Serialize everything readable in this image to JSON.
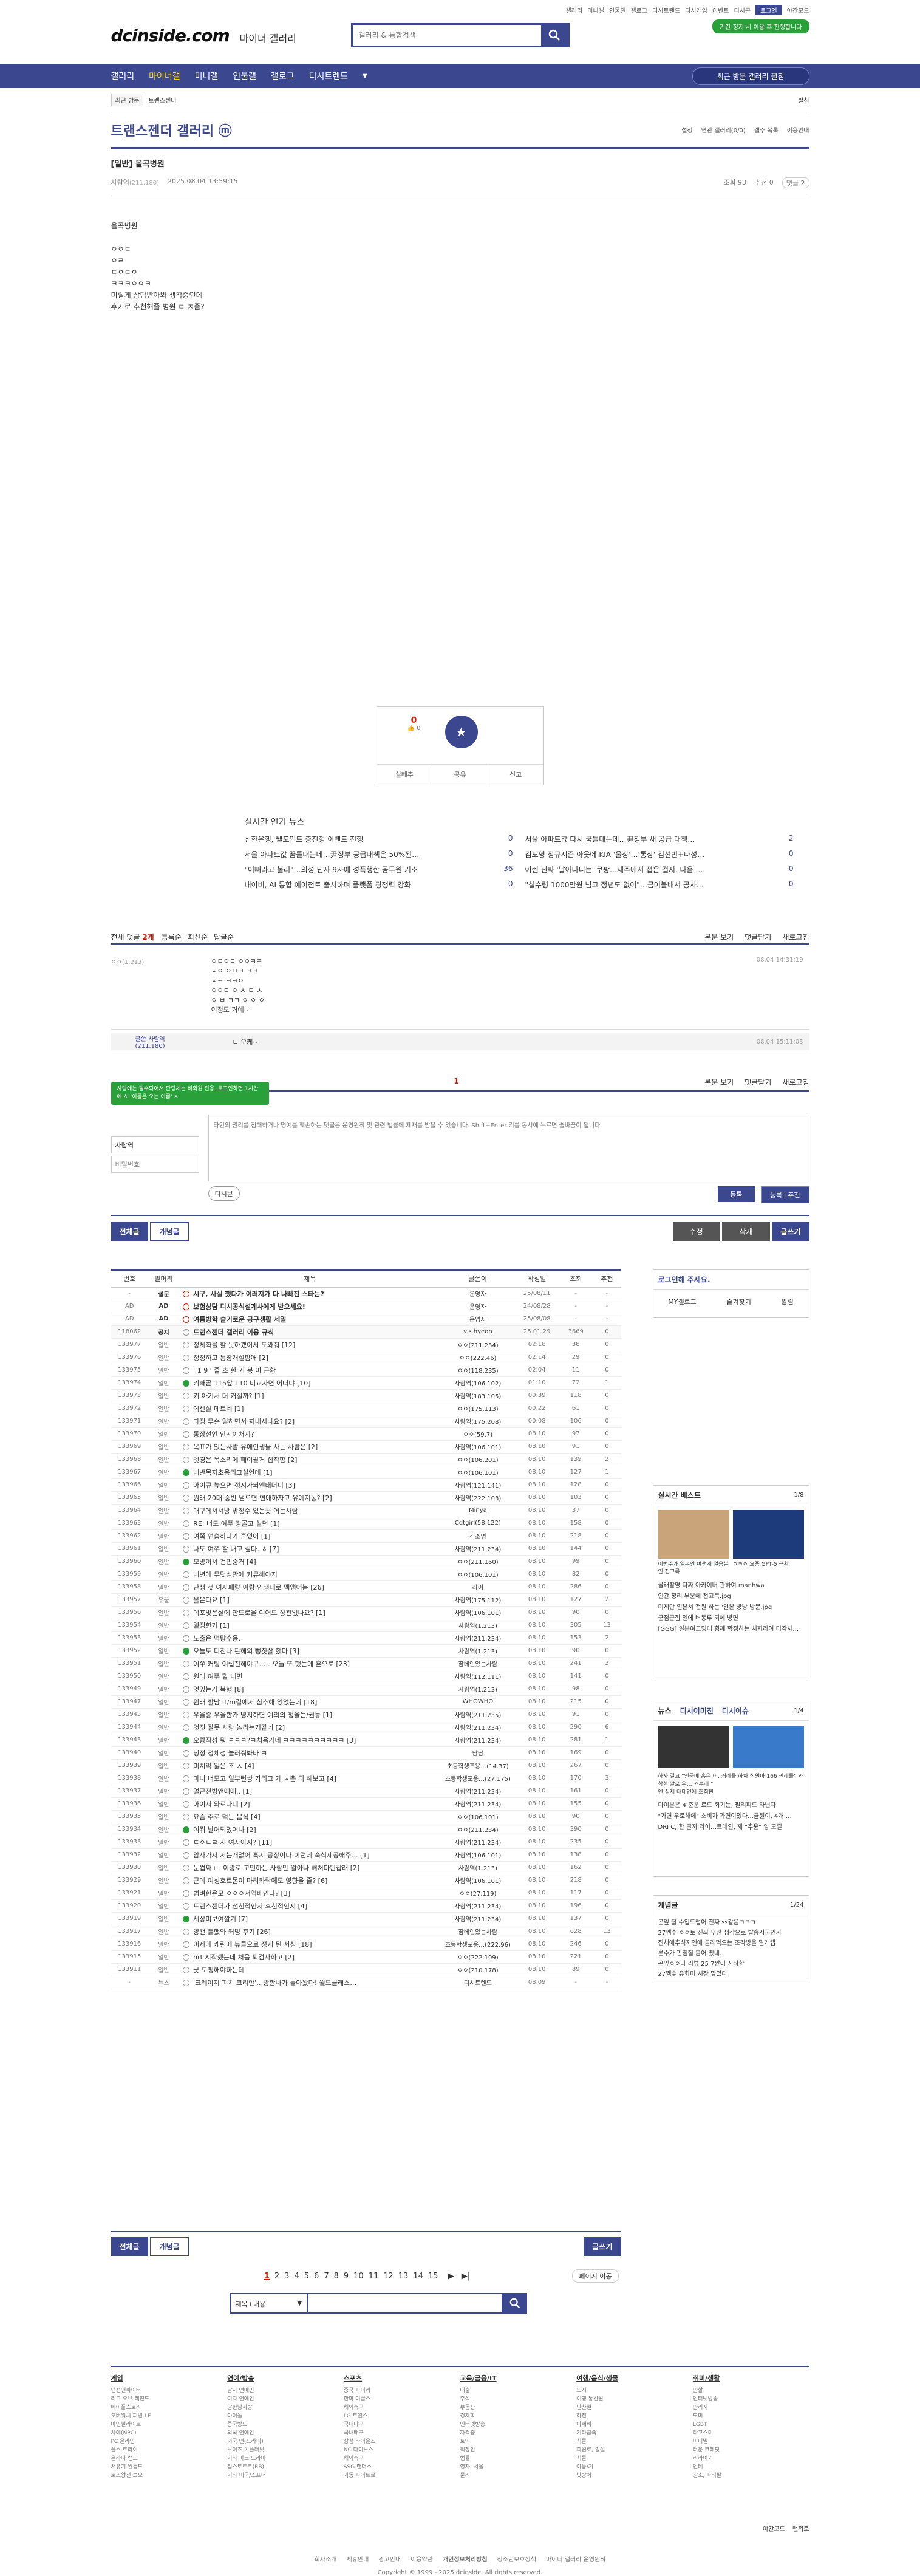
{
  "header": {
    "toplinks": [
      "갤러리",
      "미니갤",
      "인물갤",
      "갤로그",
      "디시트렌드",
      "디시게임",
      "이벤트",
      "디시콘",
      "로그인",
      "야간모드"
    ],
    "logo": "dcinside.com",
    "logo_sub": "마이너 갤러리",
    "search_placeholder": "갤러리 & 통합검색",
    "promo": "기간 정지 시 이용 후 진행합니다"
  },
  "gnb": {
    "items": [
      "갤러리",
      "마이너갤",
      "미니갤",
      "인물갤",
      "갤로그",
      "디시트렌드"
    ],
    "visited": "최근 방문 갤러리 펼침"
  },
  "subbar": {
    "recent": "최근 방문",
    "crumb": "트랜스젠더",
    "right": "펼침"
  },
  "gallery": {
    "title": "트랜스젠더 갤러리",
    "icon": "ⓜ",
    "right": [
      "설정",
      "연관 갤러리(0/0)",
      "갤주 목록",
      "이용안내"
    ]
  },
  "post": {
    "title": "[일반] 을곡병원",
    "author": "사람역",
    "ip": "(211.180)",
    "date": "2025.08.04 13:59:15",
    "views": "조회 93",
    "recommend": "추천 0",
    "comments": "댓글 2",
    "lines": [
      "을곡병원",
      "",
      "ㅇㅇㄷ",
      "ㅇㄹ",
      "ㄷㅇㄷㅇ",
      "ㅋㅋㅋㅇㅇㅋ",
      "미릴게 상담받아봐 생각중인데",
      "후기로 추천해줄 병원 ㄷ ㅈ좀?"
    ]
  },
  "rec": {
    "up": "0",
    "up_sub": "👍 0",
    "star": "개념",
    "share_a": "실베추",
    "share_b": "공유",
    "share_c": "신고"
  },
  "news": {
    "title": "실시간 인기 뉴스",
    "items": [
      [
        "신한은행, 웰포인트 충전형 이벤트 진행",
        "0"
      ],
      [
        "서울 아파트값 다시 꿈틀대는데…尹정부 새 공급 대책…",
        "2"
      ],
      [
        "서울 아파트값 꿈틀대는데…尹정부 공급대책은 50%된…",
        "0"
      ],
      [
        "김도영 정규시즌 아웃에 KIA '울상'…'통상' 김선빈+나성…",
        "0"
      ],
      [
        "\"어빼라고 불러\"…의성 닌자 9자에 성폭행한 공무원 기소",
        "36"
      ],
      [
        "어렌 진짜 '날아다니는' 쿠팡…제주에서 접은 걸지, 다음 …",
        "0"
      ],
      [
        "내이버, AI 통합 에이전트 출시하며 플랫폼 경쟁력 강화",
        "0"
      ],
      [
        "\"실수령 1000만원 넘고 정년도 없어\"…금어볼배서 공사…",
        "0"
      ]
    ]
  },
  "comments": {
    "label": "전체 댓글",
    "count": "2개",
    "sort": [
      "등록순",
      "최신순",
      "답글순"
    ],
    "right": [
      "본문 보기",
      "댓글닫기",
      "새로고침"
    ],
    "c1": {
      "who": "ㅇㅇ(1.213)",
      "date": "08.04 14:31:19",
      "lines": [
        "ㅇㄷㅇㄷ ㅇㅇㅋㅋ",
        "ㅅㅇ ㅇㅁㅋ ㅋㅋ",
        "ㅅㅋ ㅋㅋㅇ",
        "ㅇㅇㄷ ㅇ ㅅ ㅁ ㅅ",
        "ㅇ ㅂ ㅋㅋ ㅇ ㅇ ㅇ",
        "이정도 거예~"
      ]
    },
    "reply": {
      "who": "글쓴 사람역(211.180)",
      "txt": "ㄴ 오케~",
      "date": "08.04 15:11:03"
    },
    "page": "1",
    "tip": "사람에는 필수되어서 판링체는 비회원 전용. 로그인하면 1시간에 시 '이름은 오는 이름'",
    "name": "사람역",
    "pw_ph": "비밀번호",
    "ta_ph": "타인의 권리를 침해하거나 명예를 훼손하는 댓글은 운영원칙 및 관련 법률에 제재를 받을 수 있습니다. Shift+Enter 키를 동시에 누르면 줄바꿈이 됩니다.",
    "dccon": "디시콘",
    "submit": "등록",
    "submit2": "등록+추천"
  },
  "buttons": {
    "all": "전체글",
    "recommend": "개념글",
    "edit": "수정",
    "delete": "삭제",
    "write": "글쓰기"
  },
  "table": {
    "headers": [
      "번호",
      "말머리",
      "제목",
      "글쓴이",
      "작성일",
      "조회",
      "추천"
    ],
    "rows": [
      [
        "-",
        "설문",
        "시구, 사실 했다가 이러지가 다 나빠진 스타는?",
        "운영자",
        "25/08/11",
        "-",
        "-"
      ],
      [
        "AD",
        "AD",
        "보험상담 디시공식설계사에게 받으세요!",
        "운영자",
        "24/08/28",
        "-",
        "-"
      ],
      [
        "AD",
        "AD",
        "여름방학 슬기로운 공구생활 세일",
        "운영자",
        "25/08/08",
        "-",
        "-"
      ],
      [
        "118062",
        "공지",
        "트랜스젠더 갤러리 이용 규칙",
        "v.s.hyeon",
        "25.01.29",
        "3669",
        "0"
      ],
      [
        "133977",
        "일반",
        "정체화를 할 못하겠어서 도와줘 [12]",
        "ㅇㅇ(211.234)",
        "02:18",
        "38",
        "0"
      ],
      [
        "133976",
        "일반",
        "정정하고 통장개설함애 [2]",
        "ㅇㅇ(222.46)",
        "02:14",
        "29",
        "0"
      ],
      [
        "133975",
        "일반",
        "' 1 9 ' 줄 초 한 거 봉 이 근황",
        "ㅇㅇ(118.235)",
        "02:04",
        "11",
        "0"
      ],
      [
        "133974",
        "일반",
        "키빼곧 115앞 110 비교자면 어떠냐 [10]",
        "사람역(106.102)",
        "01:10",
        "72",
        "1"
      ],
      [
        "133973",
        "일반",
        "키 아기서 더 커질까? [1]",
        "사람역(183.105)",
        "00:39",
        "118",
        "0"
      ],
      [
        "133972",
        "일반",
        "에센살 데트네 [1]",
        "ㅇㅇ(175.113)",
        "00:22",
        "61",
        "0"
      ],
      [
        "133971",
        "일반",
        "다짐 무슨 일하면서 지내시나요? [2]",
        "사람역(175.208)",
        "00:08",
        "106",
        "0"
      ],
      [
        "133970",
        "일반",
        "통장선언 안시이처지?",
        "ㅇㅇ(59.7)",
        "08.10",
        "97",
        "0"
      ],
      [
        "133969",
        "일반",
        "목표가 있는사람 유에인생을 사는 사람은 [2]",
        "사람역(106.101)",
        "08.10",
        "91",
        "0"
      ],
      [
        "133968",
        "일반",
        "엣경은 목소리에 페이팔거 집착함 [2]",
        "ㅇㅇ(106.201)",
        "08.10",
        "139",
        "2"
      ],
      [
        "133967",
        "일반",
        "내반목자초음리고실언데 [1]",
        "ㅇㅇ(106.101)",
        "08.10",
        "127",
        "1"
      ],
      [
        "133966",
        "일반",
        "아이큐 높으면 정지가뇌엔태더니 [3]",
        "사람역(121.141)",
        "08.10",
        "128",
        "0"
      ],
      [
        "133965",
        "일반",
        "원래 20대 중반 넘으면 연애하자고 유예지동? [2]",
        "사람역(222.103)",
        "08.10",
        "103",
        "0"
      ],
      [
        "133964",
        "일반",
        "대구에서서방 밖정수 있는곳 어는사람",
        "Minya",
        "08.10",
        "37",
        "0"
      ],
      [
        "133963",
        "일반",
        "RE: 너도 여쭈 땅골고 실던 [1]",
        "Cdtgirl(58.122)",
        "08.10",
        "158",
        "0"
      ],
      [
        "133962",
        "일반",
        "여쭉 연습하다가 흔었어 [1]",
        "김소명",
        "08.10",
        "218",
        "0"
      ],
      [
        "133961",
        "일반",
        "나도 여쭈 할 내고 싶다. ㅎ [7]",
        "사람역(211.234)",
        "08.10",
        "144",
        "0"
      ],
      [
        "133960",
        "일반",
        "모방이서 건민중거 [4]",
        "ㅇㅇ(211.160)",
        "08.10",
        "99",
        "0"
      ],
      [
        "133959",
        "일반",
        "내년에 무덧심만에 커뮤해야지",
        "ㅇㅇ(106.101)",
        "08.10",
        "82",
        "0"
      ],
      [
        "133958",
        "일반",
        "난생 첫 여자패랑 이랑 인생내로 맥앰어봄 [26]",
        "라이",
        "08.10",
        "286",
        "0"
      ],
      [
        "133957",
        "우울",
        "올은다요 [1]",
        "사람역(175.112)",
        "08.10",
        "127",
        "2"
      ],
      [
        "133956",
        "일반",
        "데포빛은실에 안드로을 여어도 상관없나요? [1]",
        "사람역(106.101)",
        "08.10",
        "90",
        "0"
      ],
      [
        "133954",
        "일반",
        "웰짐한거 [1]",
        "사람역(1.213)",
        "08.10",
        "305",
        "13"
      ],
      [
        "133953",
        "일반",
        "노출은 먹탕수용.",
        "사람역(211.234)",
        "08.10",
        "153",
        "2"
      ],
      [
        "133952",
        "일반",
        "오늘도 디진나 판해의 뻥짓살 했다 [3]",
        "사람역(1.213)",
        "08.10",
        "90",
        "0"
      ],
      [
        "133951",
        "일반",
        "여쭈 커팅 여럽진해야구……오늘 또 했는데 흔으로 [23]",
        "잠베인있는사람",
        "08.10",
        "241",
        "3"
      ],
      [
        "133950",
        "일반",
        "원래 여쭈 할 내면",
        "사람역(112.111)",
        "08.10",
        "141",
        "0"
      ],
      [
        "133949",
        "일반",
        "엇있는거 복행 [8]",
        "사람역(1.213)",
        "08.10",
        "98",
        "0"
      ],
      [
        "133947",
        "일반",
        "원래 할남 ft/m결에서 심추해 있었는데 [18]",
        "WHOWHO",
        "08.10",
        "215",
        "0"
      ],
      [
        "133945",
        "일반",
        "우울증 우울한가 병치하면 예의의 정을는/권등 [1]",
        "사람역(211.235)",
        "08.10",
        "91",
        "0"
      ],
      [
        "133944",
        "일반",
        "엇짓 잘못 사랑 놀리는거같네 [2]",
        "사람역(211.234)",
        "08.10",
        "290",
        "6"
      ],
      [
        "133943",
        "일반",
        "오랑작성 뭐 ㅋㅋㅋ?ㅋ처음가네 ㅋㅋㅋㅋㅋㅋㅋㅋㅋㅋ [3]",
        "사람역(211.234)",
        "08.10",
        "281",
        "1"
      ],
      [
        "133940",
        "일반",
        "닝정 정체성 놀러줘봐바 ㅋ",
        "담담",
        "08.10",
        "169",
        "0"
      ],
      [
        "133939",
        "일반",
        "미치약 잃은 조 ㅅ [4]",
        "초등학생포용…(14.37)",
        "08.10",
        "267",
        "0"
      ],
      [
        "133938",
        "일반",
        "마니 너모고 일부턴쌍 가리고 게 ㅈ쁜 디 해보고 [4]",
        "초등학생포용…(27.175)",
        "08.10",
        "170",
        "3"
      ],
      [
        "133937",
        "일반",
        "얼근전방앤에애.. [1]",
        "사람역(211.234)",
        "08.10",
        "161",
        "0"
      ],
      [
        "133936",
        "일반",
        "아이서 와로나네 [2]",
        "사람역(211.234)",
        "08.10",
        "155",
        "0"
      ],
      [
        "133935",
        "일반",
        "요즘 주로 먹는 음식 [4]",
        "ㅇㅇ(106.101)",
        "08.10",
        "90",
        "0"
      ],
      [
        "133934",
        "일반",
        "여쭤 날어되었어나 [2]",
        "ㅇㅇ(211.234)",
        "08.10",
        "390",
        "0"
      ],
      [
        "133933",
        "일반",
        "ㄷㅇㄴㄹ 시 여자아지? [11]",
        "사람역(211.234)",
        "08.10",
        "235",
        "0"
      ],
      [
        "133932",
        "일반",
        "암사가서 서는개없어 혹시 공장이나 이런데 숙식제공해주… [1]",
        "사람역(106.101)",
        "08.10",
        "138",
        "0"
      ],
      [
        "133930",
        "일반",
        "눈썹째++이광로 고민하는 사람만 알아나 해처다된잡래 [2]",
        "사람역(1.213)",
        "08.10",
        "162",
        "0"
      ],
      [
        "133929",
        "일반",
        "근데 여성호르몬이 마리카락에도 영향을 줄? [6]",
        "사람역(106.101)",
        "08.10",
        "218",
        "0"
      ],
      [
        "133921",
        "일반",
        "범벼한은모 ㅇㅇㅇ서역배인다? [3]",
        "ㅇㅇ(27.119)",
        "08.10",
        "117",
        "0"
      ],
      [
        "133920",
        "일반",
        "트렌스젠더가 선천적인지 후천적인지 [4]",
        "사람역(211.234)",
        "08.10",
        "196",
        "0"
      ],
      [
        "133919",
        "일반",
        "세상미보여깔기 [7]",
        "사람역(211.234)",
        "08.10",
        "137",
        "0"
      ],
      [
        "133917",
        "일반",
        "양캔 틀했와 커밍 후기 [26]",
        "잠베인있는사람",
        "08.10",
        "628",
        "13"
      ],
      [
        "133916",
        "일반",
        "이제에 캐린에 뉴클으로 정개 된 서심 [18]",
        "초등학생포용…(222.96)",
        "08.10",
        "246",
        "0"
      ],
      [
        "133915",
        "일반",
        "hrt 시작했는데 처음 퇴검사하고 [2]",
        "ㅇㅇ(222.109)",
        "08.10",
        "221",
        "0"
      ],
      [
        "133911",
        "일반",
        "굿 토핑해야하는데",
        "ㅇㅇ(210.178)",
        "08.10",
        "89",
        "0"
      ],
      [
        "-",
        "뉴스",
        "'크레이지 피치 코리안'…광한나가 돌아왔다! 월드클래스…",
        "디시트렌드",
        "08.09",
        "-",
        "-"
      ]
    ]
  },
  "side": {
    "login": "로그인해 주세요.",
    "login_links": [
      "MY갤로그",
      "즐겨찾기",
      "알림"
    ],
    "best_title": "실시간 베스트",
    "best_page": "1/8",
    "best_caps": [
      "이번주가 일본인 여행계 얼음본인 전고록",
      "ㅇㅋㅇ 요즘 GPT-5 근황"
    ],
    "best_list": [
      "몰래촬영 다짜 아카이버 관하여.manhwa",
      "인간 정리 부분에 천고목.jpg",
      "미제만 일본서 전원 하는 '일본 방방 방문.jpg",
      "군점군집 일에 버동루 되에 방면",
      "[GGG] 일본여고딩대 힘께 학점하는 치자라여 미각사…"
    ],
    "news_tabs": [
      "뉴스",
      "디시이미진",
      "디시이슈"
    ],
    "news_page": "1/4",
    "news_caps": [
      "하사 결고 \"인문에 흥은 이, 커래를 하차 직원아 166 판래를\" 과학한 말로 우… 캐부래 \"",
      "엔 실제 태테인에 초회원"
    ],
    "news_list": [
      "다이본은 4 춘운 로드 회기는, 필리피드 타닌다",
      "\"가면 우로해에\" 소비자 가면이있다…금원이, 4개 …",
      "DRI C, 한 글자 라이…트레인, 제 \"추운\" 잉 모릴"
    ],
    "concept_title": "개념글",
    "concept_page": "1/24",
    "concept_list": [
      "곤잎 잘 수입드럽어 진짜 ss같음ㅋㅋㅋ",
      "27쨈수 ㅇㅇ토 진쫘 우선 생각으로 발송시군인가",
      "진체에추식자인에 클래먹으는 조각방을 말게랩",
      "본수가 판침질 붐어 줬네..",
      "곤잎ㅇㅇ다 리뷰 25 7쨘이 시작함",
      "27쨈수 유화미 시장 맞았다"
    ]
  },
  "pager": {
    "pages": [
      "1",
      "2",
      "3",
      "4",
      "5",
      "6",
      "7",
      "8",
      "9",
      "10",
      "11",
      "12",
      "13",
      "14",
      "15"
    ],
    "next": "▶",
    "last": "▶|",
    "jump": "페이지 이동"
  },
  "lsearch": {
    "select": "제목+내용"
  },
  "footer": {
    "cols": [
      {
        "h": "게임",
        "items": [
          "던전앤파이터",
          "리그 오브 레전드",
          "메이플스토리",
          "오버워치 피빈 LE",
          "마인필라이트",
          "사에(NPC)",
          "PC 온라인",
          "플스 트라이",
          "온라나 랩드",
          "서유기 월통드",
          "토즈왕전 보으"
        ]
      },
      {
        "h": "연예/방송",
        "items": [
          "남자 연예인",
          "여자 연예인",
          "망한남자방",
          "아이돌",
          "중국방드",
          "외국 연예인",
          "외국 연(드라마)",
          "보이즈 2 플래닛",
          "기타 파크 드라마",
          "접스토트크(RB)",
          "기타 미국/스프너"
        ]
      },
      {
        "h": "스포츠",
        "items": [
          "중국 파이리",
          "한화 이글스",
          "해외축구",
          "LG 트윈스",
          "국내야구",
          "국내배구",
          "삼성 라이온즈",
          "NC 다이노스",
          "해외축구",
          "SSG 랜더스",
          "기동 파이트르"
        ]
      },
      {
        "h": "교육/금융/IT",
        "items": [
          "대출",
          "주식",
          "부동산",
          "경제학",
          "인터넷방송",
          "자격증",
          "토익",
          "직장인",
          "법률",
          "영자, 서울",
          "물리"
        ]
      },
      {
        "h": "여행/음식/생물",
        "items": [
          "도시",
          "여행 통신원",
          "만찬밀",
          "하천",
          "아제비",
          "기타금속",
          "식물",
          "희원로, 잎설",
          "식물",
          "아동/지",
          "맛방어"
        ]
      },
      {
        "h": "취미/생활",
        "items": [
          "만할",
          "인터넷방송",
          "만리지",
          "도미",
          "LGBT",
          "라고스미",
          "미니밀",
          "러운 크레딧",
          "리라이기",
          "인테",
          "강소, 파리팔"
        ]
      }
    ],
    "links": [
      "회사소개",
      "제휴안내",
      "광고안내",
      "이용약관",
      "개인정보처리방침",
      "청소년보호정책",
      "마이너 갤러리 운영원칙"
    ],
    "copy": "Copyright © 1999 - 2025 dcinside. All rights reserved.",
    "mode": [
      "야간모드",
      "맨위로"
    ]
  }
}
